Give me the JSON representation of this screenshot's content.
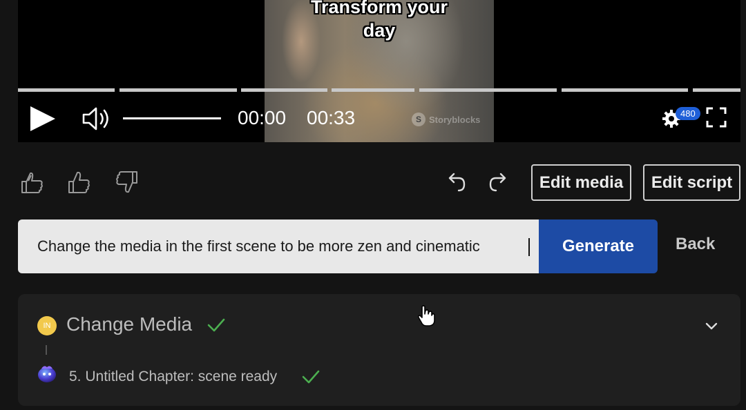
{
  "player": {
    "caption_line1": "Transform your",
    "caption_line2": "day",
    "watermark": "Storyblocks",
    "watermark_icon": "S",
    "current_time": "00:00",
    "duration": "00:33",
    "quality_badge": "480"
  },
  "toolbar": {
    "edit_media_label": "Edit media",
    "edit_script_label": "Edit script"
  },
  "prompt": {
    "value": "Change the media in the first scene to be more zen and cinematic",
    "generate_label": "Generate",
    "back_label": "Back"
  },
  "task": {
    "badge": "IN",
    "title": "Change Media",
    "step": "5. Untitled Chapter: scene ready"
  },
  "colors": {
    "accent": "#1d4ba5",
    "success": "#4caf50",
    "badge_yellow": "#f2c94c",
    "quality_blue": "#1f5fd8"
  }
}
